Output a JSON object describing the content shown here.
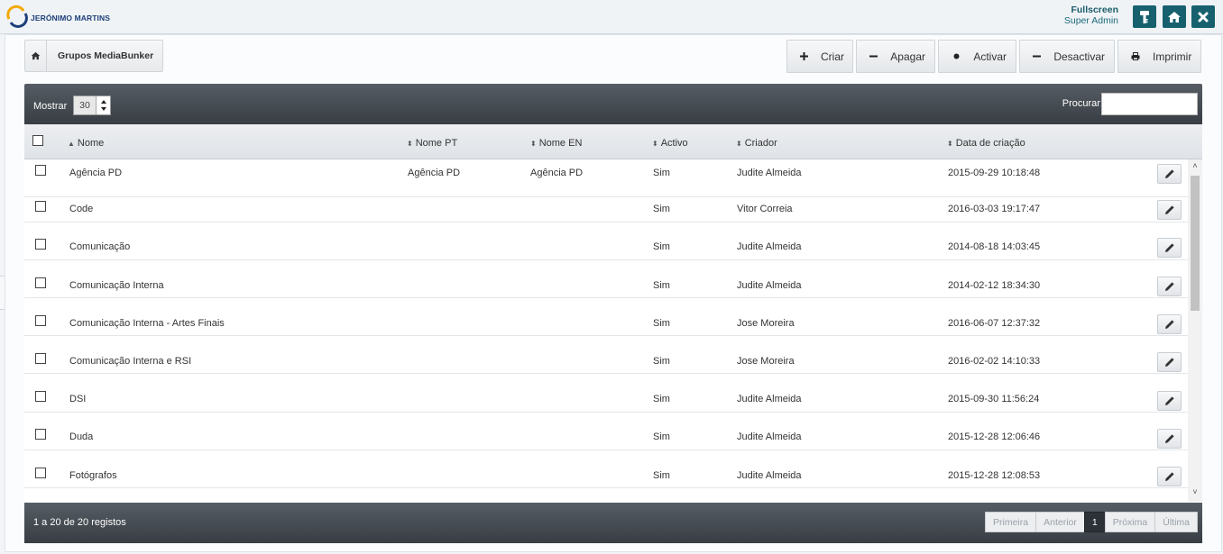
{
  "header": {
    "brand": "JERÓNIMO MARTINS",
    "fullscreen_label": "Fullscreen",
    "user_role": "Super Admin",
    "icons": [
      "key-icon",
      "home-icon",
      "close-icon"
    ],
    "accent": "#17616e"
  },
  "breadcrumb": {
    "items": [
      "Grupos MediaBunker"
    ]
  },
  "toolbar": {
    "create": "Criar",
    "delete": "Apagar",
    "activate": "Activar",
    "deactivate": "Desactivar",
    "print": "Imprimir"
  },
  "grid": {
    "show_label": "Mostrar",
    "page_size": "30",
    "search_label": "Procurar:",
    "search_value": "",
    "columns": [
      "Nome",
      "Nome PT",
      "Nome EN",
      "Activo",
      "Criador",
      "Data de criação"
    ],
    "rows": [
      {
        "name": "Agência PD",
        "name_pt": "Agência PD",
        "name_en": "Agência PD",
        "active": "Sim",
        "creator": "Judite Almeida",
        "created": "2015-09-29 10:18:48"
      },
      {
        "name": "Code",
        "name_pt": "",
        "name_en": "",
        "active": "Sim",
        "creator": "Vitor Correia",
        "created": "2016-03-03 19:17:47"
      },
      {
        "name": "Comunicação",
        "name_pt": "",
        "name_en": "",
        "active": "Sim",
        "creator": "Judite Almeida",
        "created": "2014-08-18 14:03:45"
      },
      {
        "name": "Comunicação Interna",
        "name_pt": "",
        "name_en": "",
        "active": "Sim",
        "creator": "Judite Almeida",
        "created": "2014-02-12 18:34:30"
      },
      {
        "name": "Comunicação Interna - Artes Finais",
        "name_pt": "",
        "name_en": "",
        "active": "Sim",
        "creator": "Jose Moreira",
        "created": "2016-06-07 12:37:32"
      },
      {
        "name": "Comunicação Interna e RSI",
        "name_pt": "",
        "name_en": "",
        "active": "Sim",
        "creator": "Jose Moreira",
        "created": "2016-02-02 14:10:33"
      },
      {
        "name": "DSI",
        "name_pt": "",
        "name_en": "",
        "active": "Sim",
        "creator": "Judite Almeida",
        "created": "2015-09-30 11:56:24"
      },
      {
        "name": "Duda",
        "name_pt": "",
        "name_en": "",
        "active": "Sim",
        "creator": "Judite Almeida",
        "created": "2015-12-28 12:06:46"
      },
      {
        "name": "Fotógrafos",
        "name_pt": "",
        "name_en": "",
        "active": "Sim",
        "creator": "Judite Almeida",
        "created": "2015-12-28 12:08:53"
      }
    ]
  },
  "footer": {
    "info": "1 a 20 de 20 registos",
    "first": "Primeira",
    "prev": "Anterior",
    "page": "1",
    "next": "Próxima",
    "last": "Última"
  }
}
